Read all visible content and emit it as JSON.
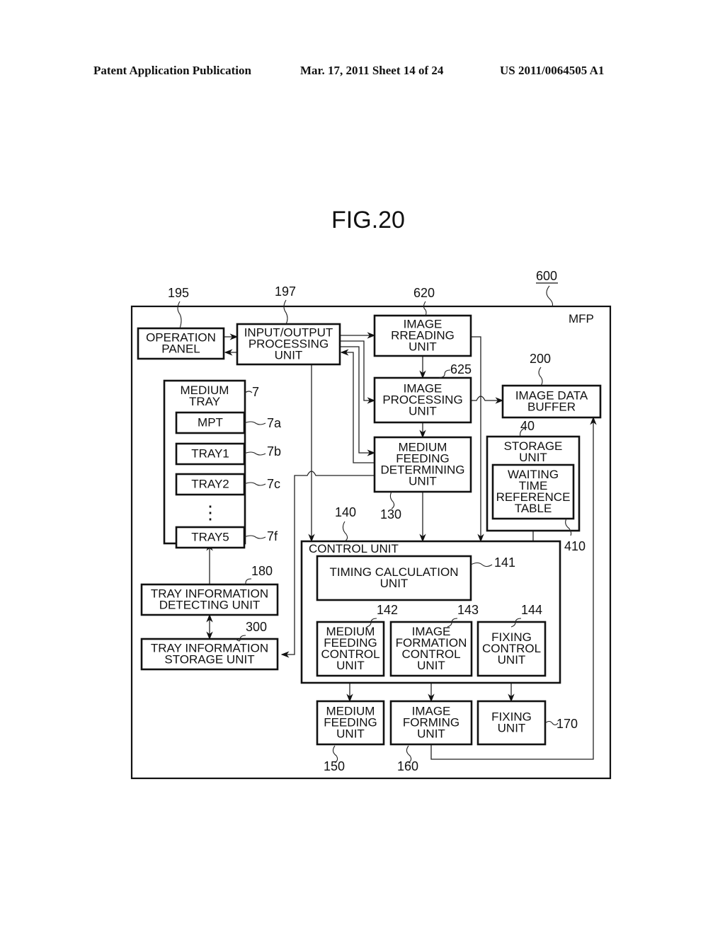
{
  "header": {
    "left": "Patent Application Publication",
    "middle": "Mar. 17, 2011  Sheet 14 of 24",
    "right": "US 2011/0064505 A1"
  },
  "figure": {
    "title": "FIG.20",
    "system_ref": "600",
    "system_label": "MFP"
  },
  "blocks": {
    "operation_panel": {
      "lines": [
        "OPERATION",
        "PANEL"
      ],
      "ref": "195"
    },
    "io_processing": {
      "lines": [
        "INPUT/OUTPUT",
        "PROCESSING",
        "UNIT"
      ],
      "ref": "197"
    },
    "image_reading": {
      "lines": [
        "IMAGE",
        "RREADING",
        "UNIT"
      ],
      "ref": "620"
    },
    "image_processing": {
      "lines": [
        "IMAGE",
        "PROCESSING",
        "UNIT"
      ],
      "ref": "625"
    },
    "image_data_buffer": {
      "lines": [
        "IMAGE  DATA",
        "BUFFER"
      ],
      "ref": "200"
    },
    "medium_tray": {
      "lines": [
        "MEDIUM",
        "TRAY"
      ],
      "ref": "7"
    },
    "mpt": {
      "lines": [
        "MPT"
      ],
      "ref": "7a"
    },
    "tray1": {
      "lines": [
        "TRAY1"
      ],
      "ref": "7b"
    },
    "tray2": {
      "lines": [
        "TRAY2"
      ],
      "ref": "7c"
    },
    "tray_ellipsis": "⋮",
    "tray5": {
      "lines": [
        "TRAY5"
      ],
      "ref": "7f"
    },
    "medium_feeding_determining": {
      "lines": [
        "MEDIUM",
        "FEEDING",
        "DETERMINING",
        "UNIT"
      ],
      "ref": "130"
    },
    "storage_unit": {
      "lines": [
        "STORAGE",
        "UNIT"
      ],
      "ref": "40"
    },
    "waiting_time_table": {
      "lines": [
        "WAITING",
        "TIME",
        "REFERENCE",
        "TABLE"
      ],
      "ref": "410"
    },
    "control_unit": {
      "lines": [
        "CONTROL  UNIT"
      ],
      "ref": "140"
    },
    "timing_calculation": {
      "lines": [
        "TIMING  CALCULATION",
        "UNIT"
      ],
      "ref": "141"
    },
    "medium_feeding_control": {
      "lines": [
        "MEDIUM",
        "FEEDING",
        "CONTROL",
        "UNIT"
      ],
      "ref": "142"
    },
    "image_formation_control": {
      "lines": [
        "IMAGE",
        "FORMATION",
        "CONTROL",
        "UNIT"
      ],
      "ref": "143"
    },
    "fixing_control": {
      "lines": [
        "FIXING",
        "CONTROL",
        "UNIT"
      ],
      "ref": "144"
    },
    "tray_info_detecting": {
      "lines": [
        "TRAY  INFORMATION",
        "DETECTING  UNIT"
      ],
      "ref": "180"
    },
    "tray_info_storage": {
      "lines": [
        "TRAY  INFORMATION",
        "STORAGE  UNIT"
      ],
      "ref": "300"
    },
    "medium_feeding_unit": {
      "lines": [
        "MEDIUM",
        "FEEDING",
        "UNIT"
      ],
      "ref": "150"
    },
    "image_forming_unit": {
      "lines": [
        "IMAGE",
        "FORMING",
        "UNIT"
      ],
      "ref": "160"
    },
    "fixing_unit": {
      "lines": [
        "FIXING",
        "UNIT"
      ],
      "ref": "170"
    }
  }
}
